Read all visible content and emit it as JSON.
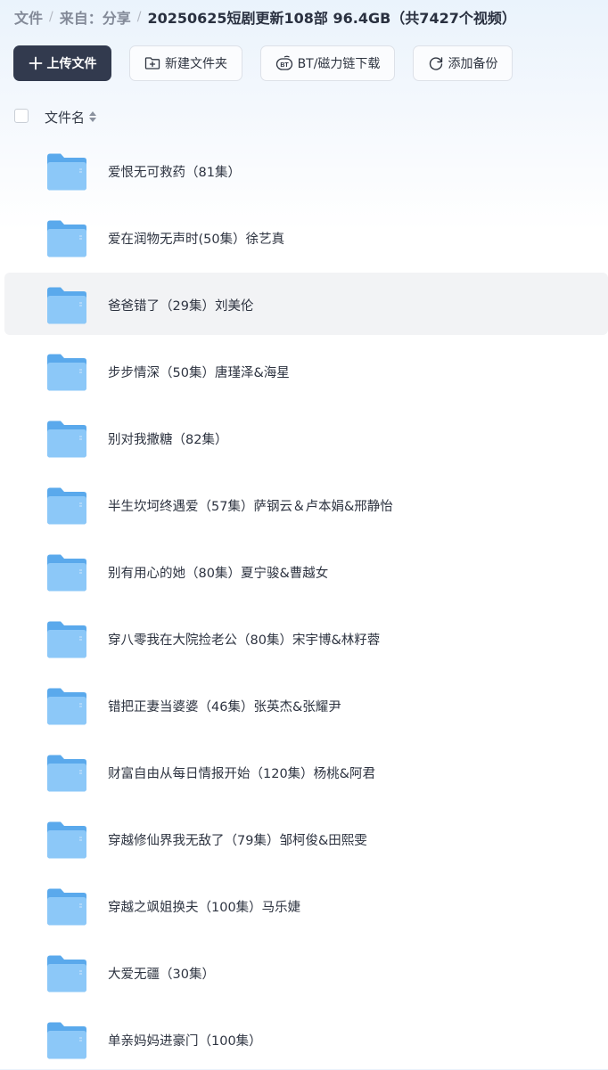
{
  "breadcrumb": {
    "root": "文件",
    "source": "来自：分享",
    "current": "20250625短剧更新108部 96.4GB（共7427个视频）"
  },
  "toolbar": {
    "upload": "上传文件",
    "new_folder": "新建文件夹",
    "bt_download": "BT/磁力链下载",
    "add_backup": "添加备份"
  },
  "list_header": {
    "name_label": "文件名"
  },
  "files": [
    {
      "name": "爱恨无可救药（81集）",
      "type": "folder"
    },
    {
      "name": "爱在润物无声时(50集）徐艺真",
      "type": "folder"
    },
    {
      "name": "爸爸错了（29集）刘美伦",
      "type": "folder",
      "hovered": true
    },
    {
      "name": "步步情深（50集）唐瑾泽&海星",
      "type": "folder"
    },
    {
      "name": "别对我撒糖（82集）",
      "type": "folder"
    },
    {
      "name": "半生坎坷终遇爱（57集）萨钢云＆卢本娟&邢静怡",
      "type": "folder"
    },
    {
      "name": "别有用心的她（80集）夏宁骏&曹越女",
      "type": "folder"
    },
    {
      "name": "穿八零我在大院捡老公（80集）宋宇博&林籽蓉",
      "type": "folder"
    },
    {
      "name": "错把正妻当婆婆（46集）张英杰&张耀尹",
      "type": "folder"
    },
    {
      "name": "财富自由从每日情报开始（120集）杨桃&阿君",
      "type": "folder"
    },
    {
      "name": "穿越修仙界我无敌了（79集）邹柯俊&田熙雯",
      "type": "folder"
    },
    {
      "name": "穿越之飒姐换夫（100集）马乐婕",
      "type": "folder"
    },
    {
      "name": "大爱无疆（30集）",
      "type": "folder"
    },
    {
      "name": "单亲妈妈进豪门（100集）",
      "type": "folder"
    }
  ],
  "colors": {
    "primary_button": "#323a4e",
    "row_hover": "#f2f3f5",
    "folder_back": "#5aa9ec",
    "folder_front": "#8cc8f8"
  },
  "icons": [
    "plus-icon",
    "new-folder-icon",
    "bt-icon",
    "backup-icon",
    "sort-icon",
    "folder-icon"
  ]
}
